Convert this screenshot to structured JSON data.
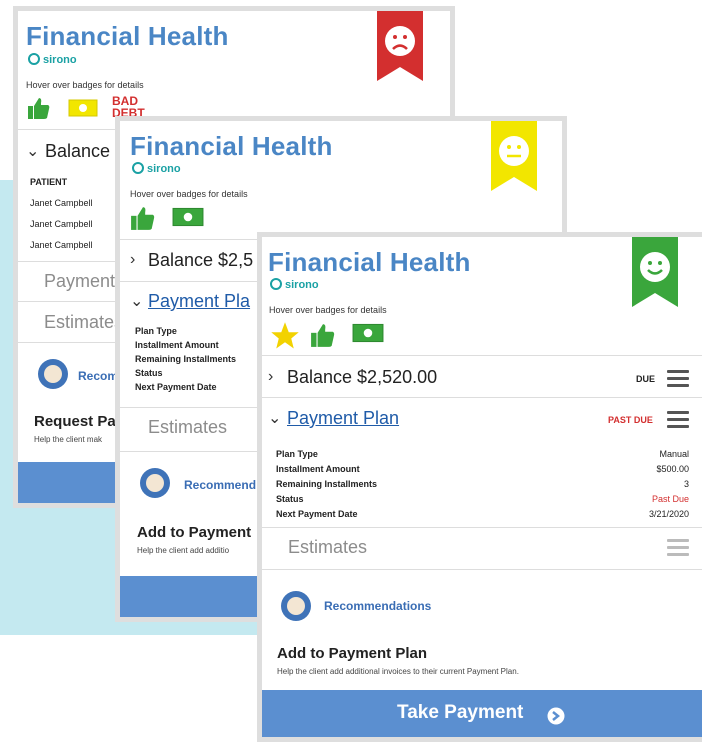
{
  "colors": {
    "title": "#4a86c5",
    "brand": "#1aa1a4",
    "red": "#d32f2f",
    "yellow": "#f2e600",
    "green": "#3aa63c",
    "button": "#5b8fd0",
    "pastdue": "#d32f2f"
  },
  "card1": {
    "title": "Financial Health",
    "brand": "sirono",
    "hover": "Hover over badges for details",
    "bad_debt": "BAD DEBT",
    "balance": "Balance $",
    "table_header": "PATIENT",
    "patients": [
      "Janet Campbell",
      "Janet Campbell",
      "Janet Campbell"
    ],
    "payment": "Payment",
    "estimates": "Estimates",
    "recommendations": "Recom",
    "request_title": "Request Pay",
    "request_sub": "Help the client mak"
  },
  "card2": {
    "title": "Financial Health",
    "brand": "sirono",
    "hover": "Hover over badges for details",
    "balance": "Balance $2,5",
    "payment_plan": "Payment Pla",
    "labels": [
      "Plan Type",
      "Installment Amount",
      "Remaining Installments",
      "Status",
      "Next Payment Date"
    ],
    "estimates": "Estimates",
    "recommendations": "Recommend",
    "add_title": "Add to Payment",
    "add_sub": "Help the client add additio"
  },
  "card3": {
    "title": "Financial Health",
    "brand": "sirono",
    "hover": "Hover over badges for details",
    "balance": "Balance $2,520.00",
    "balance_status": "DUE",
    "payment_plan": "Payment Plan",
    "plan_status": "PAST DUE",
    "rows": [
      {
        "label": "Plan Type",
        "value": "Manual"
      },
      {
        "label": "Installment Amount",
        "value": "$500.00"
      },
      {
        "label": "Remaining Installments",
        "value": "3"
      },
      {
        "label": "Status",
        "value": "Past Due"
      },
      {
        "label": "Next Payment Date",
        "value": "3/21/2020"
      }
    ],
    "estimates": "Estimates",
    "recommendations": "Recommendations",
    "add_title": "Add to Payment Plan",
    "add_sub": "Help the client add additional invoices to their current Payment Plan.",
    "take_payment": "Take Payment"
  }
}
